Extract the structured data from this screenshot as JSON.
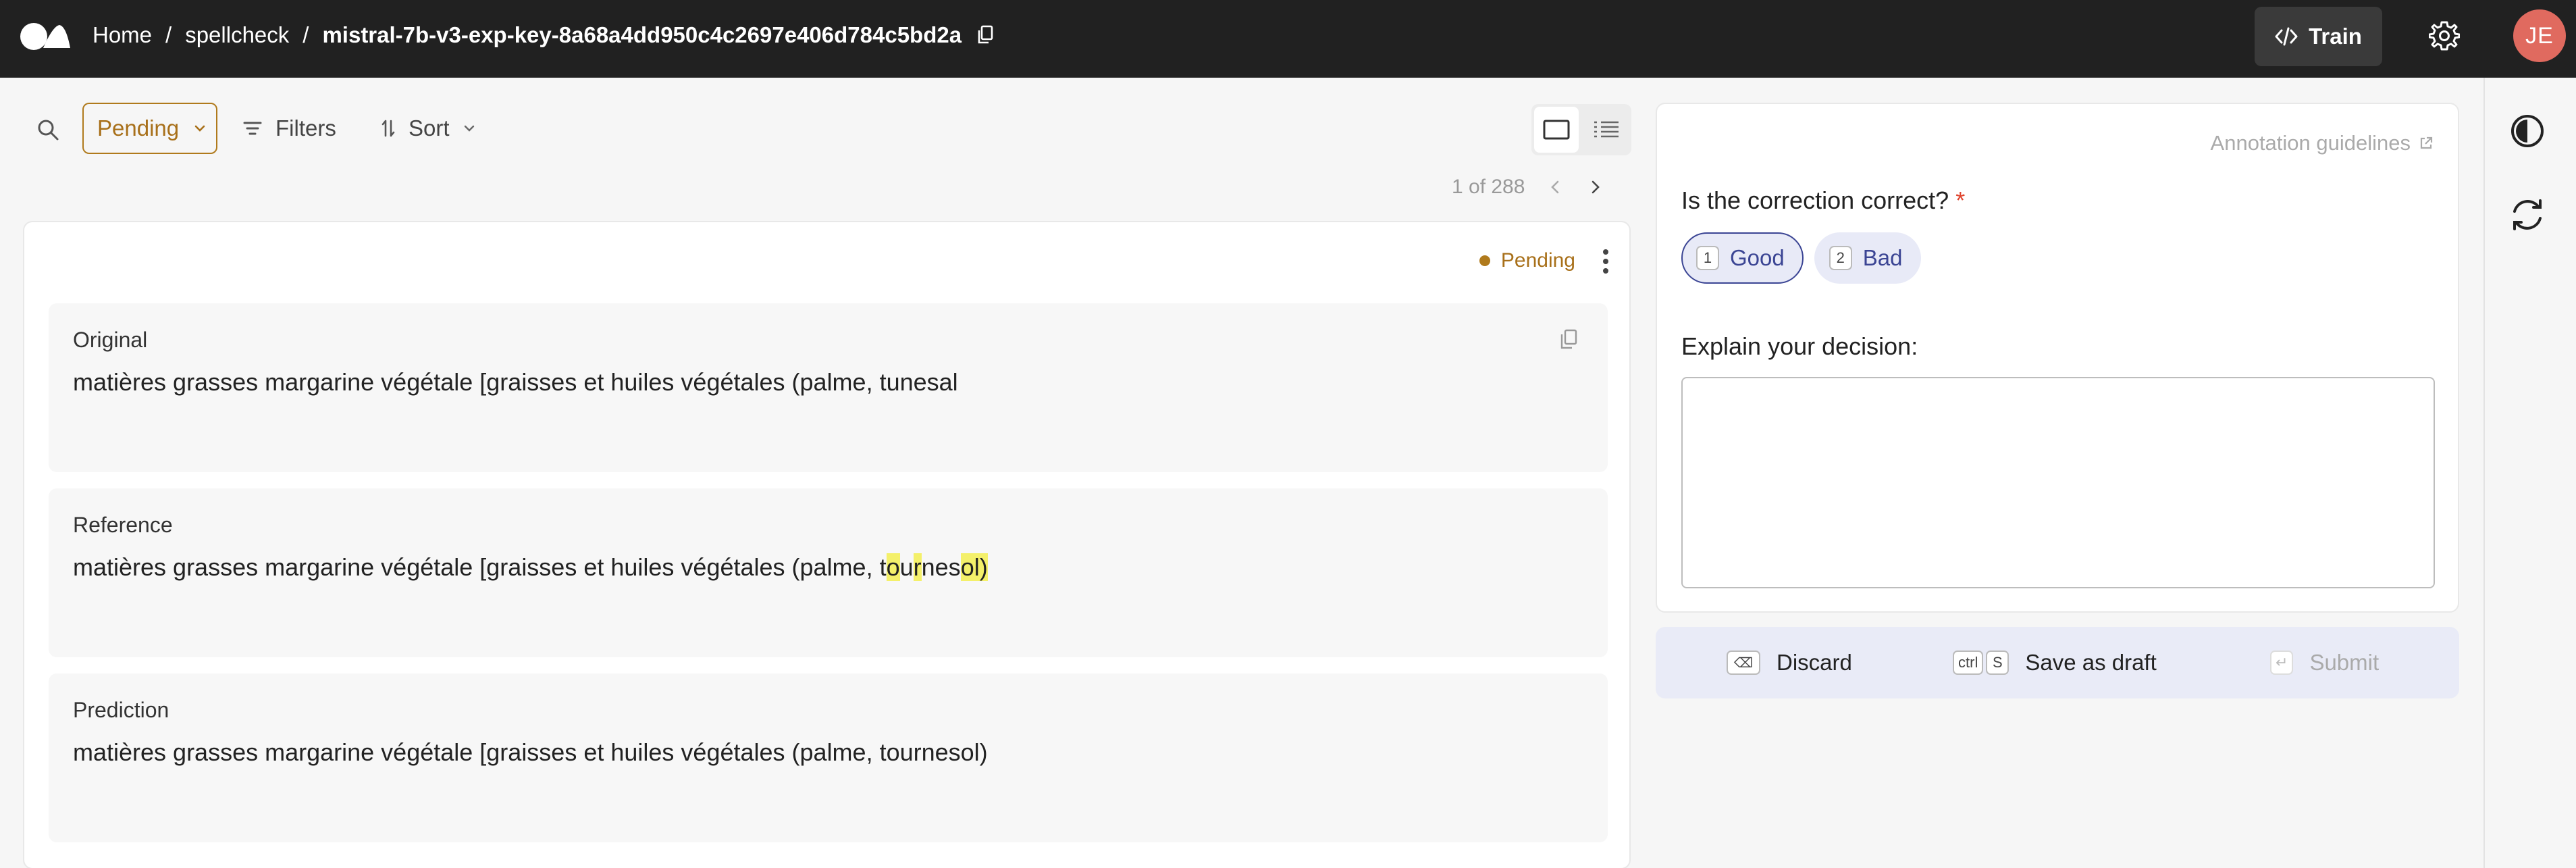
{
  "header": {
    "breadcrumbs": [
      "Home",
      "spellcheck",
      "mistral-7b-v3-exp-key-8a68a4dd950c4c2697e406d784c5bd2a"
    ],
    "separator": "/",
    "train_label": "Train",
    "avatar_initials": "JE"
  },
  "toolbar": {
    "status_filter": "Pending",
    "filters_label": "Filters",
    "sort_label": "Sort",
    "pager_text": "1 of 288"
  },
  "record": {
    "status": "Pending",
    "fields": [
      {
        "label": "Original",
        "value": "matières grasses margarine végétale [graisses et huiles végétales (palme, tunesal"
      },
      {
        "label": "Reference",
        "value_parts": [
          {
            "text": "matières grasses margarine végétale [graisses et huiles végétales (palme, t",
            "hl": false
          },
          {
            "text": "o",
            "hl": true
          },
          {
            "text": "u",
            "hl": false
          },
          {
            "text": "r",
            "hl": true
          },
          {
            "text": "nes",
            "hl": false
          },
          {
            "text": "ol)",
            "hl": true
          }
        ]
      },
      {
        "label": "Prediction",
        "value": "matières grasses margarine végétale [graisses et huiles végétales (palme, tournesol)"
      }
    ]
  },
  "annotation": {
    "guidelines_label": "Annotation guidelines",
    "question": "Is the correction correct?",
    "required_mark": "*",
    "options": [
      {
        "key": "1",
        "label": "Good",
        "selected": true
      },
      {
        "key": "2",
        "label": "Bad",
        "selected": false
      }
    ],
    "explain_label": "Explain your decision:",
    "explain_value": ""
  },
  "actions": {
    "discard_label": "Discard",
    "discard_key": "⌫",
    "draft_label": "Save as draft",
    "draft_keys": [
      "ctrl",
      "S"
    ],
    "submit_label": "Submit",
    "submit_key": "↵"
  },
  "colors": {
    "topbar": "#212121",
    "pending": "#a8701a",
    "accent": "#3b4594",
    "highlight": "#f4f06a",
    "avatar": "#e06a5f"
  }
}
